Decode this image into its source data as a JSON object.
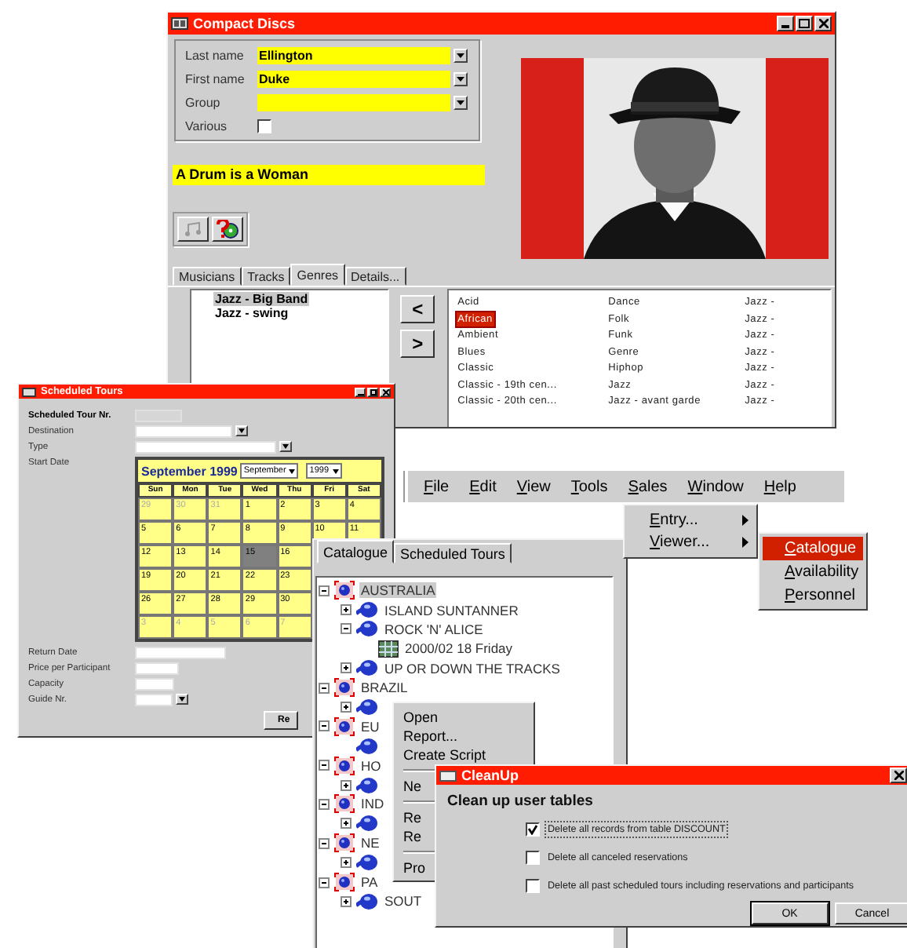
{
  "compact_discs": {
    "title": "Compact Discs",
    "fields": [
      {
        "label": "Last name",
        "value": "Ellington"
      },
      {
        "label": "First name",
        "value": "Duke"
      },
      {
        "label": "Group"
      }
    ],
    "various": {
      "label": "Various",
      "checked": false
    },
    "album_title": "A Drum is a Woman",
    "tabs": [
      {
        "label": "Musicians",
        "selected": false
      },
      {
        "label": "Tracks",
        "selected": false
      },
      {
        "label": "Genres",
        "selected": true
      },
      {
        "label": "Details...",
        "selected": false
      }
    ],
    "chosen_genres": [
      {
        "text": "Jazz - Big Band",
        "selected": true
      },
      {
        "text": "Jazz - swing",
        "selected": false
      }
    ],
    "move_buttons": [
      "<",
      ">"
    ],
    "genres": [
      [
        {
          "text": "Acid",
          "selected": false
        },
        {
          "text": "African",
          "selected": true
        },
        {
          "text": "Ambient",
          "selected": false
        },
        {
          "text": "Blues",
          "selected": false
        },
        {
          "text": "Classic",
          "selected": false
        },
        {
          "text": "Classic - 19th cen...",
          "selected": false
        },
        {
          "text": "Classic - 20th cen...",
          "selected": false
        }
      ],
      [
        {
          "text": "Dance",
          "selected": false
        },
        {
          "text": "Folk",
          "selected": false
        },
        {
          "text": "Funk",
          "selected": false
        },
        {
          "text": "Genre",
          "selected": false
        },
        {
          "text": "Hiphop",
          "selected": false
        },
        {
          "text": "Jazz",
          "selected": false
        },
        {
          "text": "Jazz - avant garde",
          "selected": false
        }
      ],
      [
        {
          "text": "Jazz -",
          "selected": false
        },
        {
          "text": "Jazz -",
          "selected": false
        },
        {
          "text": "Jazz -",
          "selected": false
        },
        {
          "text": "Jazz -",
          "selected": false
        },
        {
          "text": "Jazz -",
          "selected": false
        },
        {
          "text": "Jazz -",
          "selected": false
        },
        {
          "text": "Jazz -",
          "selected": false
        }
      ]
    ]
  },
  "scheduled_tours": {
    "title": "Scheduled Tours",
    "fields": [
      {
        "label": "Scheduled Tour Nr.",
        "kind": "readonly"
      },
      {
        "label": "Destination",
        "kind": "dropdown"
      },
      {
        "label": "Type",
        "kind": "dropdown"
      },
      {
        "label": "Start Date",
        "kind": "calendar"
      },
      {
        "label": "Return Date",
        "kind": "text"
      },
      {
        "label": "Price per Participant",
        "kind": "text"
      },
      {
        "label": "Capacity",
        "kind": "text"
      },
      {
        "label": "Guide Nr.",
        "kind": "dropdown"
      }
    ],
    "calendar": {
      "heading": "September 1999",
      "month": "September",
      "year": "1999",
      "weekdays": [
        "Sun",
        "Mon",
        "Tue",
        "Wed",
        "Thu",
        "Fri",
        "Sat"
      ],
      "weeks": [
        [
          {
            "text": "29",
            "muted": true,
            "selected": false
          },
          {
            "text": "30",
            "muted": true,
            "selected": false
          },
          {
            "text": "31",
            "muted": true,
            "selected": false
          },
          {
            "text": "1",
            "muted": false,
            "selected": false
          },
          {
            "text": "2",
            "muted": false,
            "selected": false
          },
          {
            "text": "3",
            "muted": false,
            "selected": false
          },
          {
            "text": "4",
            "muted": false,
            "selected": false
          }
        ],
        [
          {
            "text": "5",
            "muted": false,
            "selected": false
          },
          {
            "text": "6",
            "muted": false,
            "selected": false
          },
          {
            "text": "7",
            "muted": false,
            "selected": false
          },
          {
            "text": "8",
            "muted": false,
            "selected": false
          },
          {
            "text": "9",
            "muted": false,
            "selected": false
          },
          {
            "text": "10",
            "muted": false,
            "selected": false
          },
          {
            "text": "11",
            "muted": false,
            "selected": false
          }
        ],
        [
          {
            "text": "12",
            "muted": false,
            "selected": false
          },
          {
            "text": "13",
            "muted": false,
            "selected": false
          },
          {
            "text": "14",
            "muted": false,
            "selected": false
          },
          {
            "text": "15",
            "muted": false,
            "selected": true
          },
          {
            "text": "16",
            "muted": false,
            "selected": false
          }
        ],
        [
          {
            "text": "19",
            "muted": false,
            "selected": false
          },
          {
            "text": "20",
            "muted": false,
            "selected": false
          },
          {
            "text": "21",
            "muted": false,
            "selected": false
          },
          {
            "text": "22",
            "muted": false,
            "selected": false
          },
          {
            "text": "23",
            "muted": false,
            "selected": false
          }
        ],
        [
          {
            "text": "26",
            "muted": false,
            "selected": false
          },
          {
            "text": "27",
            "muted": false,
            "selected": false
          },
          {
            "text": "28",
            "muted": false,
            "selected": false
          },
          {
            "text": "29",
            "muted": false,
            "selected": false
          },
          {
            "text": "30",
            "muted": false,
            "selected": false
          }
        ],
        [
          {
            "text": "3",
            "muted": true,
            "selected": false
          },
          {
            "text": "4",
            "muted": true,
            "selected": false
          },
          {
            "text": "5",
            "muted": true,
            "selected": false
          },
          {
            "text": "6",
            "muted": true,
            "selected": false
          },
          {
            "text": "7",
            "muted": true,
            "selected": false
          }
        ]
      ]
    },
    "button": "Re"
  },
  "menu_bar": [
    "File",
    "Edit",
    "View",
    "Tools",
    "Sales",
    "Window",
    "Help"
  ],
  "sales_menu": [
    "Entry...",
    "Viewer..."
  ],
  "viewer_menu": [
    {
      "text": "Catalogue",
      "selected": true
    },
    {
      "text": "Availability",
      "selected": false
    },
    {
      "text": "Personnel",
      "selected": false
    }
  ],
  "catalogue": {
    "tabs": [
      {
        "label": "Catalogue",
        "selected": true
      },
      {
        "label": "Scheduled Tours",
        "selected": false
      }
    ],
    "tree": [
      {
        "kind": "country",
        "label": "AUSTRALIA",
        "selected": true,
        "expanded": true,
        "children": [
          {
            "kind": "tour",
            "label": "ISLAND SUNTANNER",
            "selected": false,
            "expanded": false
          },
          {
            "kind": "tour",
            "label": "ROCK 'N' ALICE",
            "selected": false,
            "expanded": true,
            "children": [
              {
                "kind": "date",
                "label": "2000/02 18 Friday",
                "selected": false
              }
            ]
          },
          {
            "kind": "tour",
            "label": "UP OR DOWN THE TRACKS",
            "selected": false,
            "expanded": false
          }
        ]
      },
      {
        "kind": "country",
        "label": "BRAZIL",
        "selected": false,
        "expanded": true,
        "children": [
          {
            "kind": "tour",
            "expanded": false
          }
        ]
      },
      {
        "kind": "country",
        "label": "EU",
        "selected": false,
        "expanded": true,
        "children": [
          {
            "kind": "tour"
          }
        ]
      },
      {
        "kind": "country",
        "label": "HO",
        "selected": false,
        "expanded": true,
        "children": [
          {
            "kind": "tour",
            "expanded": false
          }
        ]
      },
      {
        "kind": "country",
        "label": "IND",
        "selected": false,
        "expanded": true,
        "children": [
          {
            "kind": "tour",
            "expanded": false
          }
        ]
      },
      {
        "kind": "country",
        "label": "NE",
        "selected": false,
        "expanded": true,
        "children": [
          {
            "kind": "tour",
            "expanded": false
          }
        ]
      },
      {
        "kind": "country",
        "label": "PA",
        "selected": false,
        "expanded": true,
        "children": [
          {
            "kind": "tour",
            "label": "SOUT",
            "selected": false,
            "expanded": false
          }
        ]
      }
    ]
  },
  "context_menu": [
    {
      "kind": "item",
      "text": "Open"
    },
    {
      "kind": "item",
      "text": "Report..."
    },
    {
      "kind": "item",
      "text": "Create Script"
    },
    {
      "kind": "separator"
    },
    {
      "kind": "item",
      "text": "Ne"
    },
    {
      "kind": "separator"
    },
    {
      "kind": "item",
      "text": "Re"
    },
    {
      "kind": "item",
      "text": "Re"
    },
    {
      "kind": "separator"
    },
    {
      "kind": "item",
      "text": "Pro"
    }
  ],
  "cleanup": {
    "title": "CleanUp",
    "heading": "Clean up user tables",
    "options": [
      {
        "text": "Delete all records from table DISCOUNT",
        "checked": true,
        "focused": true
      },
      {
        "text": "Delete all canceled reservations",
        "checked": false,
        "focused": false
      },
      {
        "text": "Delete all past scheduled tours including reservations and participants",
        "checked": false,
        "focused": false
      }
    ],
    "buttons": [
      "OK",
      "Cancel"
    ]
  }
}
